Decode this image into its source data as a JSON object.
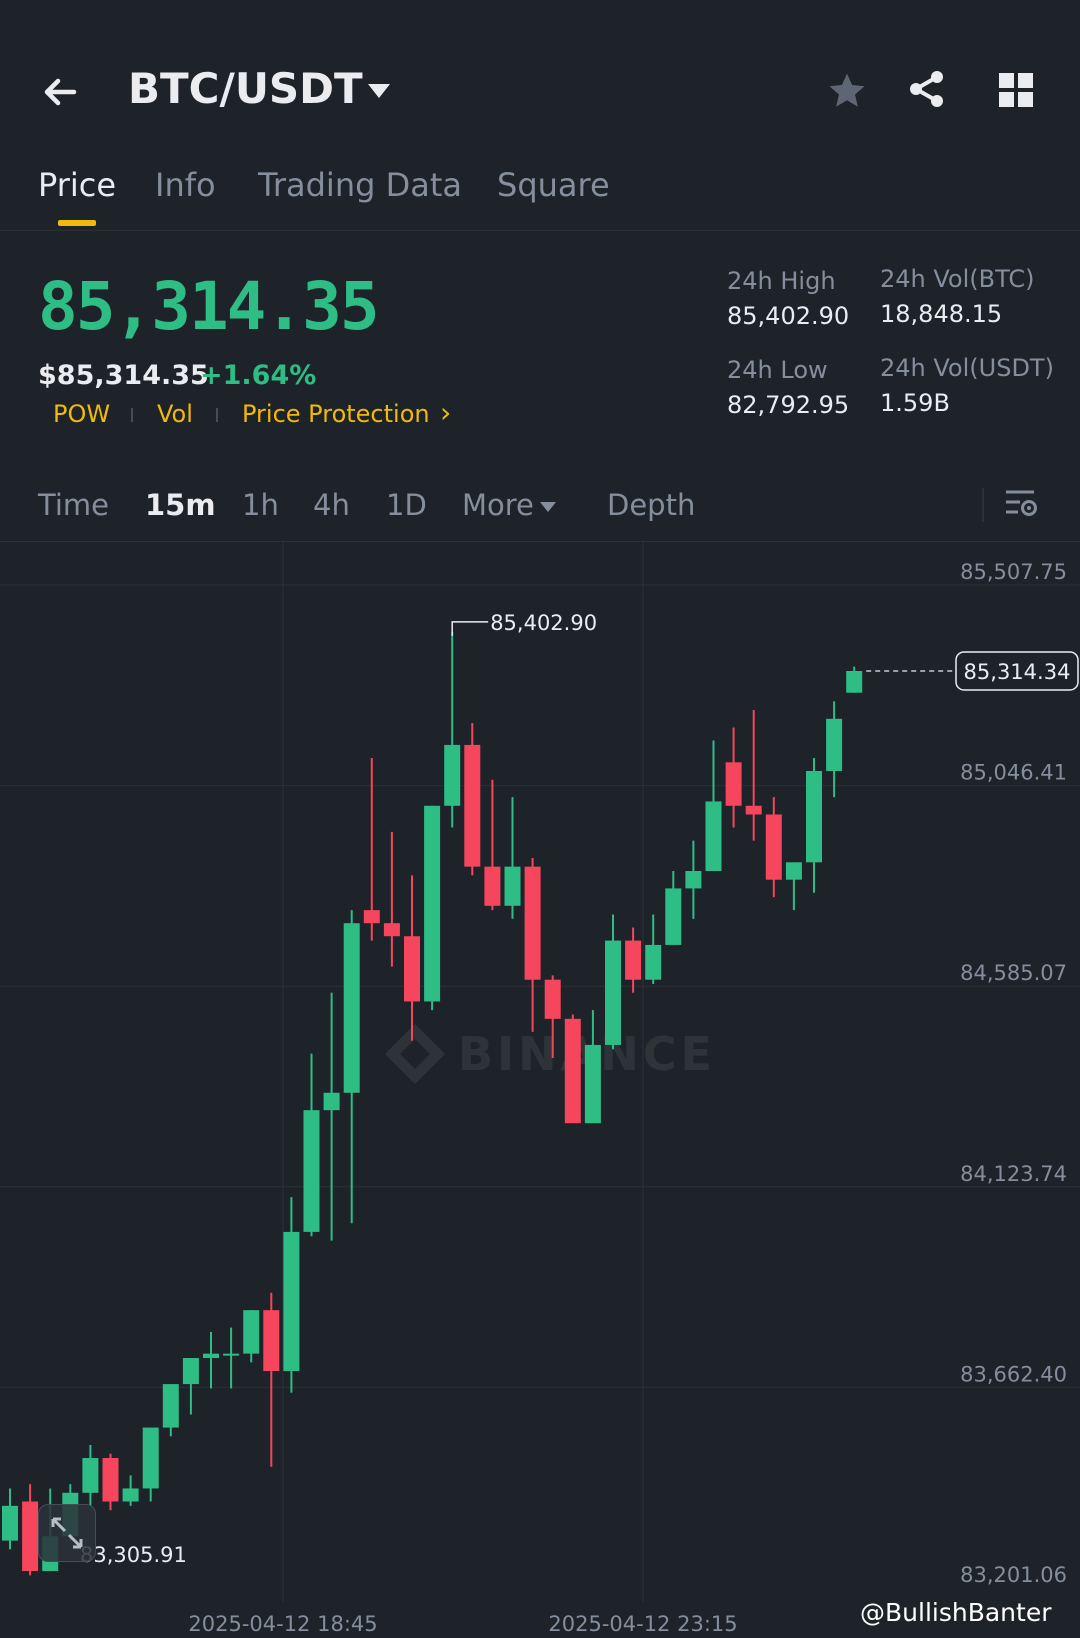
{
  "header": {
    "pair": "BTC/USDT",
    "icons": [
      "back-arrow-icon",
      "caret-down-icon",
      "star-icon",
      "share-icon",
      "grid-icon"
    ]
  },
  "tabs": [
    {
      "label": "Price",
      "active": true
    },
    {
      "label": "Info",
      "active": false
    },
    {
      "label": "Trading Data",
      "active": false
    },
    {
      "label": "Square",
      "active": false
    }
  ],
  "ticker": {
    "last_price": "85,314.35",
    "usd_price": "$85,314.35",
    "change": "+1.64%",
    "tags": [
      "POW",
      "Vol",
      "Price Protection"
    ],
    "chevron": "›"
  },
  "stats": {
    "high_label": "24h High",
    "high_value": "85,402.90",
    "low_label": "24h Low",
    "low_value": "82,792.95",
    "vol_btc_label": "24h Vol(BTC)",
    "vol_btc_value": "18,848.15",
    "vol_usdt_label": "24h Vol(USDT)",
    "vol_usdt_value": "1.59B"
  },
  "timeframes": [
    {
      "label": "Time",
      "active": false
    },
    {
      "label": "15m",
      "active": true
    },
    {
      "label": "1h",
      "active": false
    },
    {
      "label": "4h",
      "active": false
    },
    {
      "label": "1D",
      "active": false
    },
    {
      "label": "More",
      "active": false
    },
    {
      "label": "Depth",
      "active": false
    }
  ],
  "colors": {
    "up": "#2ebd85",
    "down": "#f6465d",
    "accent": "#f0b90b",
    "bg": "#1e2329",
    "grid": "#2b3139",
    "label": "#848e9c"
  },
  "chart_data": {
    "type": "candlestick",
    "y_ticks": [
      "85,507.75",
      "85,046.41",
      "84,585.07",
      "84,123.74",
      "83,662.40",
      "83,201.06"
    ],
    "ylim": [
      83201.06,
      85507.75
    ],
    "x_ticks": [
      "2025-04-12 18:45",
      "2025-04-12 23:15"
    ],
    "high_marker": "85,402.90",
    "low_marker": "83,305.91",
    "current_price": "85,314.34",
    "watermark": "BINANCE",
    "candles": [
      {
        "o": 83310,
        "h": 83430,
        "l": 83290,
        "c": 83390
      },
      {
        "o": 83400,
        "h": 83440,
        "l": 83230,
        "c": 83240
      },
      {
        "o": 83240,
        "h": 83430,
        "l": 83240,
        "c": 83320
      },
      {
        "o": 83320,
        "h": 83440,
        "l": 83310,
        "c": 83420
      },
      {
        "o": 83420,
        "h": 83530,
        "l": 83390,
        "c": 83500
      },
      {
        "o": 83500,
        "h": 83510,
        "l": 83380,
        "c": 83400
      },
      {
        "o": 83400,
        "h": 83460,
        "l": 83390,
        "c": 83430
      },
      {
        "o": 83430,
        "h": 83570,
        "l": 83400,
        "c": 83570
      },
      {
        "o": 83570,
        "h": 83650,
        "l": 83550,
        "c": 83670
      },
      {
        "o": 83670,
        "h": 83720,
        "l": 83600,
        "c": 83730
      },
      {
        "o": 83730,
        "h": 83790,
        "l": 83660,
        "c": 83740
      },
      {
        "o": 83740,
        "h": 83800,
        "l": 83660,
        "c": 83740
      },
      {
        "o": 83740,
        "h": 83840,
        "l": 83720,
        "c": 83840
      },
      {
        "o": 83840,
        "h": 83880,
        "l": 83480,
        "c": 83700
      },
      {
        "o": 83700,
        "h": 84100,
        "l": 83650,
        "c": 84020
      },
      {
        "o": 84020,
        "h": 84430,
        "l": 84010,
        "c": 84300
      },
      {
        "o": 84300,
        "h": 84570,
        "l": 84000,
        "c": 84340
      },
      {
        "o": 84340,
        "h": 84760,
        "l": 84040,
        "c": 84730
      },
      {
        "o": 84760,
        "h": 85110,
        "l": 84690,
        "c": 84730
      },
      {
        "o": 84730,
        "h": 84940,
        "l": 84630,
        "c": 84700
      },
      {
        "o": 84700,
        "h": 84840,
        "l": 84460,
        "c": 84550
      },
      {
        "o": 84550,
        "h": 85000,
        "l": 84530,
        "c": 85000
      },
      {
        "o": 85000,
        "h": 85400,
        "l": 84950,
        "c": 85140
      },
      {
        "o": 85140,
        "h": 85190,
        "l": 84840,
        "c": 84860
      },
      {
        "o": 84860,
        "h": 85060,
        "l": 84760,
        "c": 84770
      },
      {
        "o": 84770,
        "h": 85020,
        "l": 84740,
        "c": 84860
      },
      {
        "o": 84860,
        "h": 84880,
        "l": 84480,
        "c": 84600
      },
      {
        "o": 84600,
        "h": 84610,
        "l": 84420,
        "c": 84510
      },
      {
        "o": 84510,
        "h": 84520,
        "l": 84280,
        "c": 84270
      },
      {
        "o": 84270,
        "h": 84530,
        "l": 84280,
        "c": 84450
      },
      {
        "o": 84450,
        "h": 84750,
        "l": 84440,
        "c": 84690
      },
      {
        "o": 84690,
        "h": 84720,
        "l": 84570,
        "c": 84600
      },
      {
        "o": 84600,
        "h": 84750,
        "l": 84590,
        "c": 84680
      },
      {
        "o": 84680,
        "h": 84850,
        "l": 84680,
        "c": 84810
      },
      {
        "o": 84810,
        "h": 84920,
        "l": 84740,
        "c": 84850
      },
      {
        "o": 84850,
        "h": 85150,
        "l": 84850,
        "c": 85010
      },
      {
        "o": 85100,
        "h": 85180,
        "l": 84950,
        "c": 85000
      },
      {
        "o": 85000,
        "h": 85220,
        "l": 84920,
        "c": 84980
      },
      {
        "o": 84980,
        "h": 85020,
        "l": 84790,
        "c": 84830
      },
      {
        "o": 84830,
        "h": 84860,
        "l": 84760,
        "c": 84870
      },
      {
        "o": 84870,
        "h": 85110,
        "l": 84800,
        "c": 85080
      },
      {
        "o": 85080,
        "h": 85240,
        "l": 85020,
        "c": 85200
      },
      {
        "o": 85260,
        "h": 85320,
        "l": 85260,
        "c": 85310
      }
    ]
  },
  "footer": {
    "watermark": "@BullishBanter"
  }
}
